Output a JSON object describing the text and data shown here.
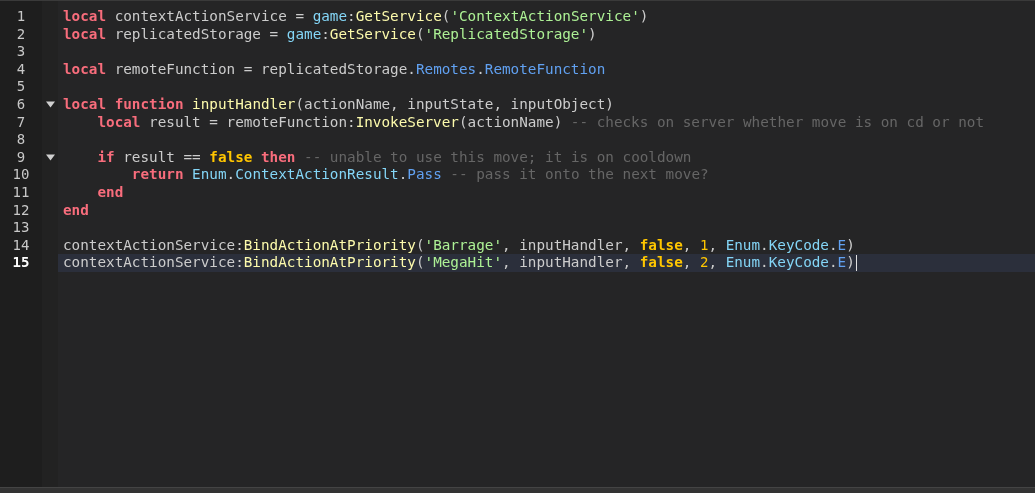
{
  "editor": {
    "lines": [
      {
        "number": "1",
        "current": false,
        "tokens": [
          {
            "kind": "kw",
            "text": "local"
          },
          {
            "kind": "p",
            "text": " contextActionService = "
          },
          {
            "kind": "bi",
            "text": "game"
          },
          {
            "kind": "p",
            "text": ":"
          },
          {
            "kind": "fn",
            "text": "GetService"
          },
          {
            "kind": "p",
            "text": "("
          },
          {
            "kind": "str",
            "text": "'ContextActionService'"
          },
          {
            "kind": "p",
            "text": ")"
          }
        ]
      },
      {
        "number": "2",
        "current": false,
        "tokens": [
          {
            "kind": "kw",
            "text": "local"
          },
          {
            "kind": "p",
            "text": " replicatedStorage = "
          },
          {
            "kind": "bi",
            "text": "game"
          },
          {
            "kind": "p",
            "text": ":"
          },
          {
            "kind": "fn",
            "text": "GetService"
          },
          {
            "kind": "p",
            "text": "("
          },
          {
            "kind": "str",
            "text": "'ReplicatedStorage'"
          },
          {
            "kind": "p",
            "text": ")"
          }
        ]
      },
      {
        "number": "3",
        "current": false
      },
      {
        "number": "4",
        "current": false,
        "tokens": [
          {
            "kind": "kw",
            "text": "local"
          },
          {
            "kind": "p",
            "text": " remoteFunction = replicatedStorage."
          },
          {
            "kind": "prop",
            "text": "Remotes"
          },
          {
            "kind": "p",
            "text": "."
          },
          {
            "kind": "prop",
            "text": "RemoteFunction"
          }
        ]
      },
      {
        "number": "5",
        "current": false
      },
      {
        "number": "6",
        "expanded": true,
        "current": false,
        "tokens": [
          {
            "kind": "kw",
            "text": "local"
          },
          {
            "kind": "kw",
            "text": " function"
          },
          {
            "kind": "fn",
            "text": " inputHandler"
          },
          {
            "kind": "p",
            "text": "(actionName, inputState, inputObject)"
          }
        ]
      },
      {
        "number": "7",
        "current": false,
        "tokens": [
          {
            "kind": "kw",
            "text": "    local"
          },
          {
            "kind": "p",
            "text": " result = remoteFunction:"
          },
          {
            "kind": "fn",
            "text": "InvokeServer"
          },
          {
            "kind": "p",
            "text": "(actionName)"
          },
          {
            "kind": "cm",
            "text": " -- checks on server whether move is on cd or not"
          }
        ]
      },
      {
        "number": "8",
        "current": false
      },
      {
        "number": "9",
        "expanded": true,
        "current": false,
        "tokens": [
          {
            "kind": "kw",
            "text": "    if"
          },
          {
            "kind": "p",
            "text": " result == "
          },
          {
            "kind": "bool",
            "text": "false"
          },
          {
            "kind": "kw",
            "text": " then"
          },
          {
            "kind": "cm",
            "text": " -- unable to use this move; it is on cooldown"
          }
        ]
      },
      {
        "number": "10",
        "current": false,
        "tokens": [
          {
            "kind": "kw",
            "text": "        return"
          },
          {
            "kind": "bi",
            "text": " Enum"
          },
          {
            "kind": "p",
            "text": "."
          },
          {
            "kind": "bi",
            "text": "ContextActionResult"
          },
          {
            "kind": "p",
            "text": "."
          },
          {
            "kind": "prop",
            "text": "Pass"
          },
          {
            "kind": "cm",
            "text": " -- pass it onto the next move?"
          }
        ]
      },
      {
        "number": "11",
        "current": false,
        "tokens": [
          {
            "kind": "kw",
            "text": "    end"
          }
        ]
      },
      {
        "number": "12",
        "current": false,
        "tokens": [
          {
            "kind": "kw",
            "text": "end"
          }
        ]
      },
      {
        "number": "13",
        "current": false
      },
      {
        "number": "14",
        "current": false,
        "tokens": [
          {
            "kind": "p",
            "text": "contextActionService:"
          },
          {
            "kind": "fn",
            "text": "BindActionAtPriority"
          },
          {
            "kind": "p",
            "text": "("
          },
          {
            "kind": "str",
            "text": "'Barrage'"
          },
          {
            "kind": "p",
            "text": ", inputHandler, "
          },
          {
            "kind": "bool",
            "text": "false"
          },
          {
            "kind": "p",
            "text": ", "
          },
          {
            "kind": "num",
            "text": "1"
          },
          {
            "kind": "p",
            "text": ", "
          },
          {
            "kind": "bi",
            "text": "Enum"
          },
          {
            "kind": "p",
            "text": "."
          },
          {
            "kind": "bi",
            "text": "KeyCode"
          },
          {
            "kind": "p",
            "text": "."
          },
          {
            "kind": "prop",
            "text": "E"
          },
          {
            "kind": "p",
            "text": ")"
          }
        ]
      },
      {
        "number": "15",
        "current": true,
        "tokens": [
          {
            "kind": "p",
            "text": "contextActionService:"
          },
          {
            "kind": "fn",
            "text": "BindActionAtPriority"
          },
          {
            "kind": "p",
            "text": "("
          },
          {
            "kind": "str",
            "text": "'MegaHit'"
          },
          {
            "kind": "p",
            "text": ", inputHandler, "
          },
          {
            "kind": "bool",
            "text": "false"
          },
          {
            "kind": "p",
            "text": ", "
          },
          {
            "kind": "num",
            "text": "2"
          },
          {
            "kind": "p",
            "text": ", "
          },
          {
            "kind": "bi",
            "text": "Enum"
          },
          {
            "kind": "p",
            "text": "."
          },
          {
            "kind": "bi",
            "text": "KeyCode"
          },
          {
            "kind": "p",
            "text": "."
          },
          {
            "kind": "prop",
            "text": "E"
          },
          {
            "kind": "p",
            "text": ")"
          }
        ]
      }
    ]
  }
}
